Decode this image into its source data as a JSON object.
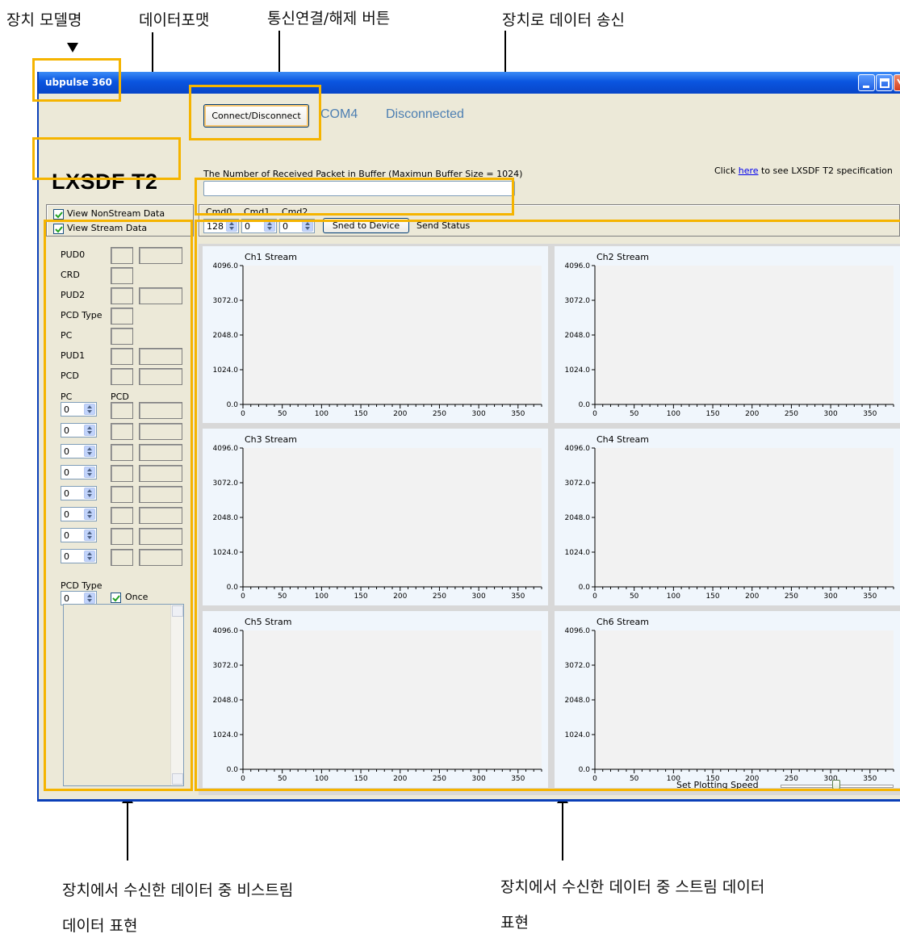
{
  "annotations": {
    "model_name": "장치 모델명",
    "data_format": "데이터포맷",
    "connect_button": "통신연결/해제 버튼",
    "send_to_device": "장치로 데이터 송신",
    "nonstream_line1": "장치에서   수신한   데이터   중   비스트림",
    "nonstream_line2": "데이터 표현",
    "stream_line1": "장치에서 수신한 데이터 중 스트림 데이터",
    "stream_line2": "표현"
  },
  "window": {
    "title": "ubpulse 360",
    "connect_label": "Connect/Disconnect",
    "port": "COM4",
    "status": "Disconnected",
    "device_name": "LXSDF T2",
    "buffer_label": "The Number of Received Packet in Buffer (Maximun Buffer Size = 1024)",
    "spec_prefix": "Click ",
    "spec_link": "here",
    "spec_suffix": " to see LXSDF T2 specification"
  },
  "options": {
    "view_nonstream": "View NonStream Data",
    "view_stream": "View Stream Data"
  },
  "command": {
    "cmd0_label": "Cmd0",
    "cmd1_label": "Cmd1",
    "cmd2_label": "Cmd2",
    "cmd0_value": "128",
    "cmd1_value": "0",
    "cmd2_value": "0",
    "send_label": "Sned to Device",
    "send_status": "Send Status"
  },
  "nonstream": {
    "fields": [
      {
        "label": "PUD0"
      },
      {
        "label": "CRD"
      },
      {
        "label": "PUD2"
      },
      {
        "label": "PCD Type"
      },
      {
        "label": "PC"
      },
      {
        "label": "PUD1"
      },
      {
        "label": "PCD"
      }
    ],
    "pc_header": "PC",
    "pcd_header": "PCD",
    "pc_values": [
      "0",
      "0",
      "0",
      "0",
      "0",
      "0",
      "0",
      "0"
    ],
    "pcd_type_label": "PCD Type",
    "pcd_type_value": "0",
    "once_label": "Once"
  },
  "plot_speed_label": "Set Plotting Speed",
  "chart_data": [
    {
      "type": "line",
      "title": "Ch1 Stream",
      "ylim": [
        0,
        4096
      ],
      "yticks": [
        "4096.0",
        "3072.0",
        "2048.0",
        "1024.0",
        "0.0"
      ],
      "xlim": [
        0,
        380
      ],
      "xticks": [
        "0",
        "50",
        "100",
        "150",
        "200",
        "250",
        "300",
        "350"
      ],
      "series": []
    },
    {
      "type": "line",
      "title": "Ch2 Stream",
      "ylim": [
        0,
        4096
      ],
      "yticks": [
        "4096.0",
        "3072.0",
        "2048.0",
        "1024.0",
        "0.0"
      ],
      "xlim": [
        0,
        380
      ],
      "xticks": [
        "0",
        "50",
        "100",
        "150",
        "200",
        "250",
        "300",
        "350"
      ],
      "series": []
    },
    {
      "type": "line",
      "title": "Ch3 Stream",
      "ylim": [
        0,
        4096
      ],
      "yticks": [
        "4096.0",
        "3072.0",
        "2048.0",
        "1024.0",
        "0.0"
      ],
      "xlim": [
        0,
        380
      ],
      "xticks": [
        "0",
        "50",
        "100",
        "150",
        "200",
        "250",
        "300",
        "350"
      ],
      "series": []
    },
    {
      "type": "line",
      "title": "Ch4 Stream",
      "ylim": [
        0,
        4096
      ],
      "yticks": [
        "4096.0",
        "3072.0",
        "2048.0",
        "1024.0",
        "0.0"
      ],
      "xlim": [
        0,
        380
      ],
      "xticks": [
        "0",
        "50",
        "100",
        "150",
        "200",
        "250",
        "300",
        "350"
      ],
      "series": []
    },
    {
      "type": "line",
      "title": "Ch5 Stram",
      "ylim": [
        0,
        4096
      ],
      "yticks": [
        "4096.0",
        "3072.0",
        "2048.0",
        "1024.0",
        "0.0"
      ],
      "xlim": [
        0,
        380
      ],
      "xticks": [
        "0",
        "50",
        "100",
        "150",
        "200",
        "250",
        "300",
        "350"
      ],
      "series": []
    },
    {
      "type": "line",
      "title": "Ch6 Stream",
      "ylim": [
        0,
        4096
      ],
      "yticks": [
        "4096.0",
        "3072.0",
        "2048.0",
        "1024.0",
        "0.0"
      ],
      "xlim": [
        0,
        380
      ],
      "xticks": [
        "0",
        "50",
        "100",
        "150",
        "200",
        "250",
        "300",
        "350"
      ],
      "series": []
    }
  ]
}
